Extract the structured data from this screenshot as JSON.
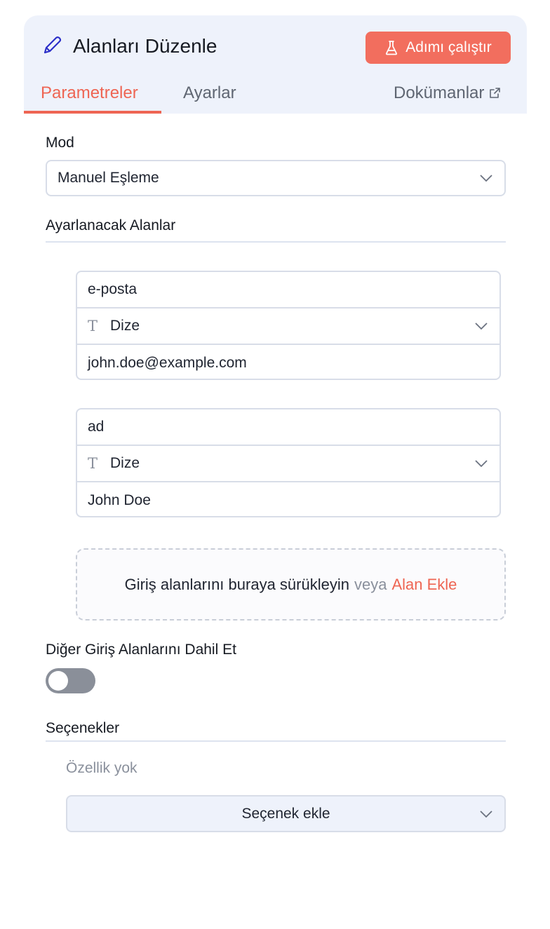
{
  "header": {
    "title": "Alanları Düzenle",
    "run_button": "Adımı çalıştır",
    "tabs": [
      {
        "label": "Parametreler",
        "active": true
      },
      {
        "label": "Ayarlar",
        "active": false
      },
      {
        "label": "Dokümanlar",
        "active": false
      }
    ]
  },
  "mode": {
    "label": "Mod",
    "value": "Manuel Eşleme"
  },
  "fields_section": {
    "label": "Ayarlanacak Alanlar",
    "fields": [
      {
        "name": "e-posta",
        "type": "Dize",
        "value": "john.doe@example.com"
      },
      {
        "name": "ad",
        "type": "Dize",
        "value": "John Doe"
      }
    ],
    "dropzone": {
      "text": "Giriş alanlarını buraya sürükleyin",
      "or": "veya",
      "link": "Alan Ekle"
    }
  },
  "include_other": {
    "label": "Diğer Giriş Alanlarını Dahil Et",
    "enabled": false
  },
  "options": {
    "label": "Seçenekler",
    "empty_text": "Özellik yok",
    "add_label": "Seçenek ekle"
  },
  "colors": {
    "accent": "#ee6553",
    "header_bg": "#eef2fb",
    "toggle_off": "#8a8f99"
  },
  "icons": [
    "pencil-icon",
    "flask-icon",
    "external-link-icon",
    "chevron-down-icon",
    "text-type-icon"
  ]
}
